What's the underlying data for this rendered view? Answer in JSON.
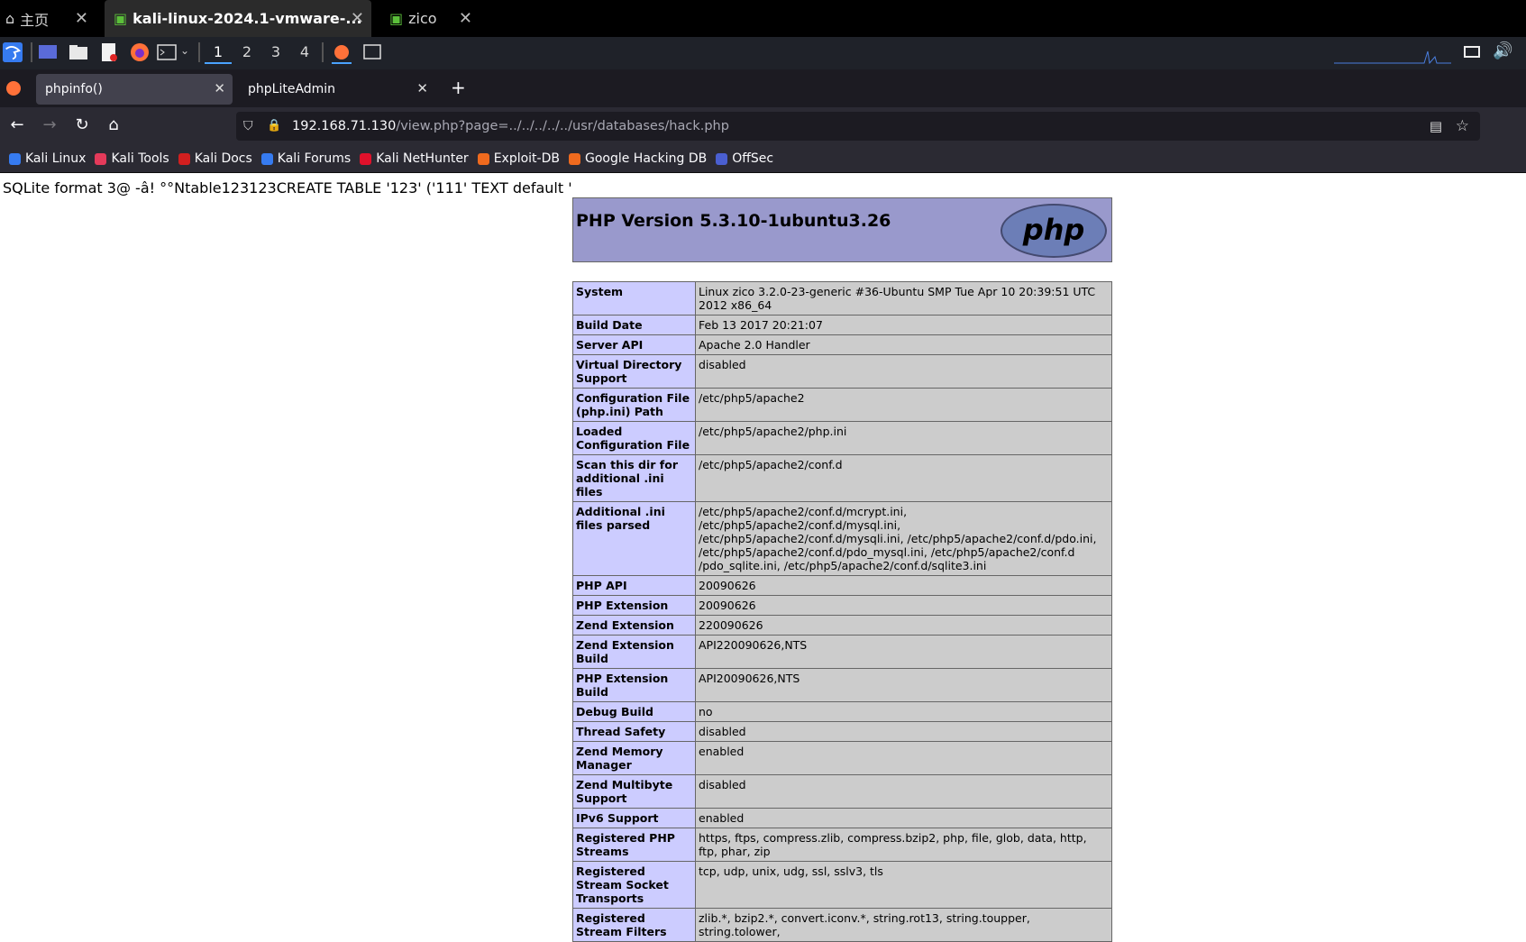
{
  "vm_tabs": [
    {
      "label": "主页",
      "icon": "home-icon"
    },
    {
      "label": "kali-linux-2024.1-vmware-...",
      "icon": "vm-icon"
    },
    {
      "label": "zico",
      "icon": "vm-icon"
    }
  ],
  "workspaces": [
    "1",
    "2",
    "3",
    "4"
  ],
  "browser_tabs": [
    {
      "label": "phpinfo()"
    },
    {
      "label": "phpLiteAdmin"
    }
  ],
  "url": {
    "host": "192.168.71.130",
    "path": "/view.php?page=../../../../../usr/databases/hack.php"
  },
  "bookmarks": [
    {
      "label": "Kali Linux",
      "color": "#367bf0"
    },
    {
      "label": "Kali Tools",
      "color": "#e43a5a"
    },
    {
      "label": "Kali Docs",
      "color": "#d21f1f"
    },
    {
      "label": "Kali Forums",
      "color": "#367bf0"
    },
    {
      "label": "Kali NetHunter",
      "color": "#e0112b"
    },
    {
      "label": "Exploit-DB",
      "color": "#ef6a1e"
    },
    {
      "label": "Google Hacking DB",
      "color": "#ef6a1e"
    },
    {
      "label": "OffSec",
      "color": "#4a5fd1"
    }
  ],
  "page": {
    "sqlite_text": "SQLite format 3@ -â! °°Ntable123123CREATE TABLE '123' ('111' TEXT default '",
    "php_version": "PHP Version 5.3.10-1ubuntu3.26",
    "php_logo": "php",
    "rows": [
      {
        "k": "System",
        "v": "Linux zico 3.2.0-23-generic #36-Ubuntu SMP Tue Apr 10 20:39:51 UTC 2012 x86_64"
      },
      {
        "k": "Build Date",
        "v": "Feb 13 2017 20:21:07"
      },
      {
        "k": "Server API",
        "v": "Apache 2.0 Handler"
      },
      {
        "k": "Virtual Directory Support",
        "v": "disabled"
      },
      {
        "k": "Configuration File (php.ini) Path",
        "v": "/etc/php5/apache2"
      },
      {
        "k": "Loaded Configuration File",
        "v": "/etc/php5/apache2/php.ini"
      },
      {
        "k": "Scan this dir for additional .ini files",
        "v": "/etc/php5/apache2/conf.d"
      },
      {
        "k": "Additional .ini files parsed",
        "v": "/etc/php5/apache2/conf.d/mcrypt.ini, /etc/php5/apache2/conf.d/mysql.ini, /etc/php5/apache2/conf.d/mysqli.ini, /etc/php5/apache2/conf.d/pdo.ini, /etc/php5/apache2/conf.d/pdo_mysql.ini, /etc/php5/apache2/conf.d /pdo_sqlite.ini, /etc/php5/apache2/conf.d/sqlite3.ini"
      },
      {
        "k": "PHP API",
        "v": "20090626"
      },
      {
        "k": "PHP Extension",
        "v": "20090626"
      },
      {
        "k": "Zend Extension",
        "v": "220090626"
      },
      {
        "k": "Zend Extension Build",
        "v": "API220090626,NTS"
      },
      {
        "k": "PHP Extension Build",
        "v": "API20090626,NTS"
      },
      {
        "k": "Debug Build",
        "v": "no"
      },
      {
        "k": "Thread Safety",
        "v": "disabled"
      },
      {
        "k": "Zend Memory Manager",
        "v": "enabled"
      },
      {
        "k": "Zend Multibyte Support",
        "v": "disabled"
      },
      {
        "k": "IPv6 Support",
        "v": "enabled"
      },
      {
        "k": "Registered PHP Streams",
        "v": "https, ftps, compress.zlib, compress.bzip2, php, file, glob, data, http, ftp, phar, zip"
      },
      {
        "k": "Registered Stream Socket Transports",
        "v": "tcp, udp, unix, udg, ssl, sslv3, tls"
      },
      {
        "k": "Registered Stream Filters",
        "v": "zlib.*, bzip2.*, convert.iconv.*, string.rot13, string.toupper, string.tolower,"
      }
    ]
  }
}
